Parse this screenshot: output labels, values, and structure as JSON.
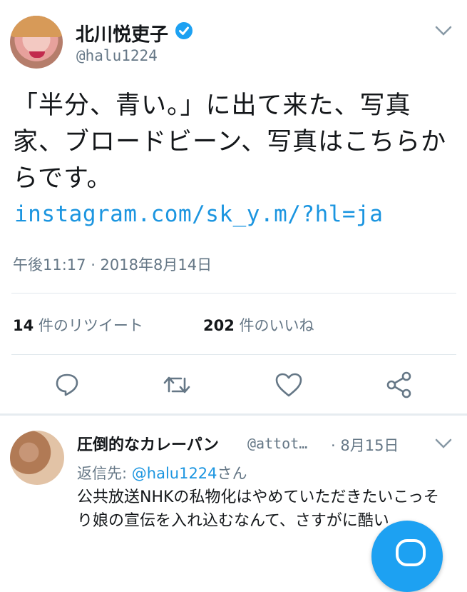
{
  "tweet": {
    "author_name": "北川悦吏子",
    "author_handle": "@halu1224",
    "text": "「半分、青い。」に出て来た、写真家、ブロードビーン、写真はこちらからです。",
    "link": "instagram.com/sk_y.m/?hl=ja",
    "timestamp": "午後11:17 · 2018年8月14日",
    "retweets_count": "14",
    "retweets_label": " 件のリツイート",
    "likes_count": "202",
    "likes_label": " 件のいいね",
    "icons": [
      "verified-icon",
      "chevron-down-icon",
      "reply-icon",
      "retweet-icon",
      "like-icon",
      "share-icon"
    ],
    "accent_color": "#1da1f2"
  },
  "reply": {
    "author_name": "圧倒的なカレーパン",
    "author_handle": "@attot…",
    "date": "· 8月15日",
    "reply_to_label": "返信先: ",
    "reply_to_handle": "@halu1224",
    "reply_to_suffix": "さん",
    "text": "公共放送NHKの私物化はやめていただきたいこっそり娘の宣伝を入れ込むなんて、さすがに酷い"
  }
}
